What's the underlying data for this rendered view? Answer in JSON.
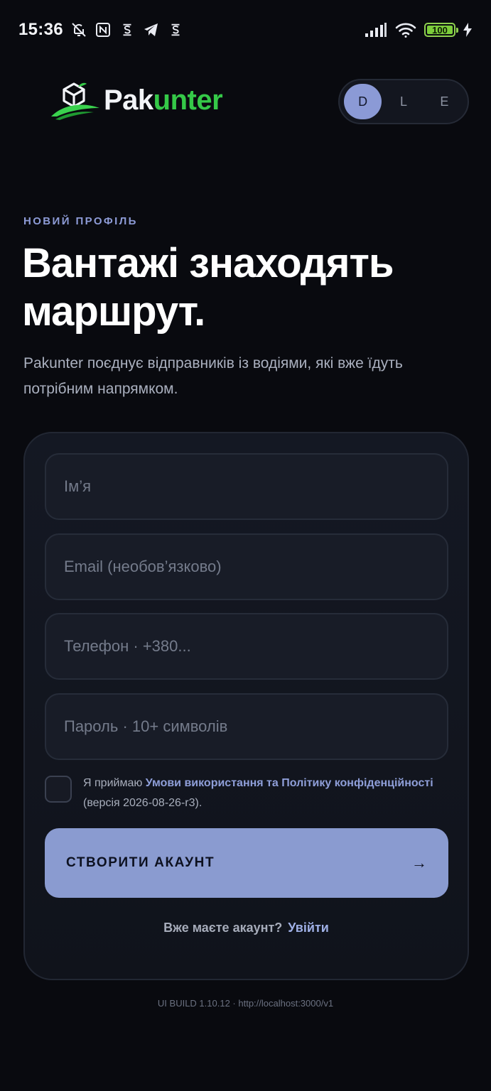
{
  "statusbar": {
    "time": "15:36",
    "battery": "100",
    "battery_level": 1.0
  },
  "brand": {
    "name_part1": "Pak",
    "name_part2": "unter",
    "accent": "#35c948"
  },
  "theme_switch": {
    "options": [
      "D",
      "L",
      "E"
    ],
    "selected": "D",
    "active_color": "#8b9ad6"
  },
  "hero": {
    "eyebrow": "НОВИЙ ПРОФІЛЬ",
    "headline": "Вантажі знаходять маршрут.",
    "subtitle": "Pakunter поєднує відправників із водіями, які вже їдуть потрібним напрямком."
  },
  "form": {
    "name_placeholder": "Ім’я",
    "email_placeholder": "Email (необов’язково)",
    "phone_placeholder": "Телефон · +380...",
    "password_placeholder": "Пароль · 10+ символів",
    "consent_prefix": "Я приймаю ",
    "consent_link": "Умови використання та Політику конфіденційності",
    "consent_suffix": " (версія 2026-08-26-r3).",
    "submit_label": "СТВОРИТИ АКАУНТ",
    "submit_arrow": "→",
    "submit_color": "#8a9bd0"
  },
  "signin": {
    "question": "Вже маєте акаунт?",
    "link": "Увійти"
  },
  "footer": {
    "build": "UI BUILD 1.10.12 · http://localhost:3000/v1"
  }
}
